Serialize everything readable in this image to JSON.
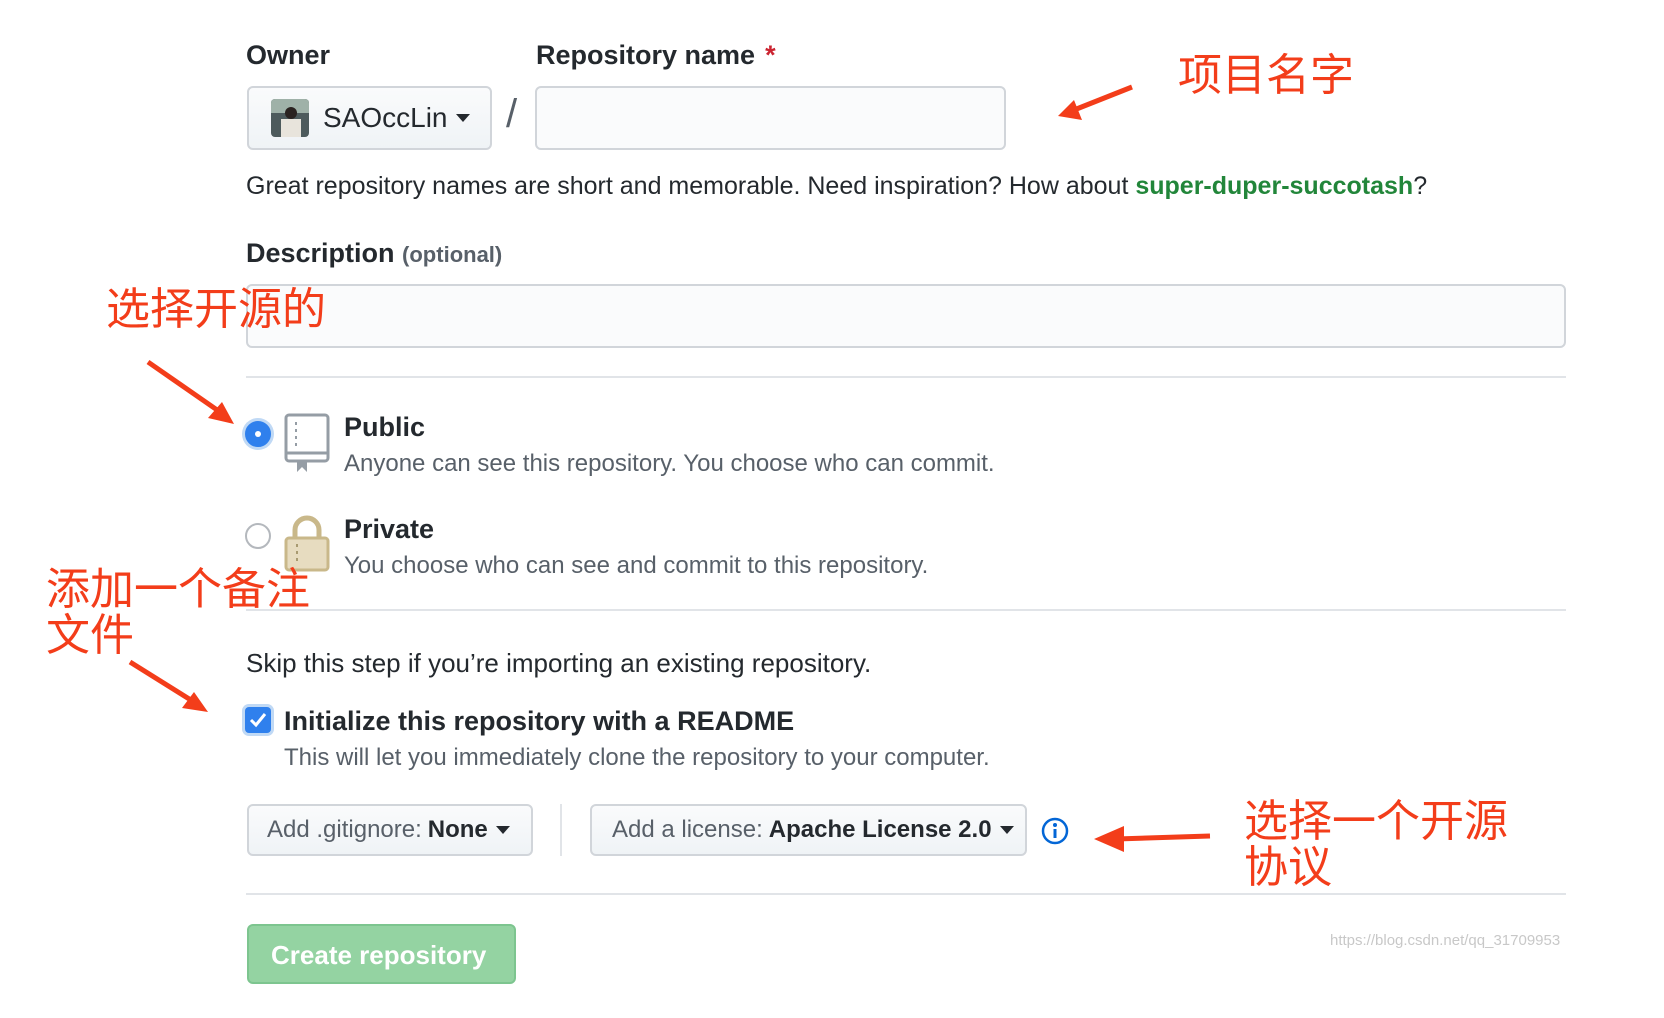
{
  "owner": {
    "label": "Owner",
    "name": "SAOccLin"
  },
  "repo": {
    "label": "Repository name",
    "required_mark": "*",
    "separator": "/",
    "value": ""
  },
  "hint": {
    "prefix": "Great repository names are short and memorable. Need inspiration? How about ",
    "suggestion": "super-duper-succotash",
    "suffix": "?"
  },
  "description": {
    "label": "Description",
    "optional": "(optional)",
    "value": ""
  },
  "visibility": {
    "public": {
      "title": "Public",
      "desc": "Anyone can see this repository. You choose who can commit.",
      "selected": true
    },
    "private": {
      "title": "Private",
      "desc": "You choose who can see and commit to this repository.",
      "selected": false
    }
  },
  "skip_text": "Skip this step if you’re importing an existing repository.",
  "readme": {
    "label": "Initialize this repository with a README",
    "desc": "This will let you immediately clone the repository to your computer.",
    "checked": true
  },
  "gitignore": {
    "prefix": "Add .gitignore:",
    "value": "None"
  },
  "license": {
    "prefix": "Add a license:",
    "value": "Apache License 2.0"
  },
  "create_button": "Create repository",
  "annotations": {
    "repo_name": "项目名字",
    "public": "选择开源的",
    "readme_line1": "添加一个备注",
    "readme_line2": "文件",
    "license_line1": "选择一个开源",
    "license_line2": "协议"
  },
  "watermark": "https://blog.csdn.net/qq_31709953",
  "colors": {
    "annotation": "#f33d1a",
    "suggestion": "#22863a",
    "accent": "#2f80ed",
    "create_button": "#94d3a2"
  },
  "icons": [
    "repo-book-icon",
    "lock-icon",
    "info-icon",
    "checkmark-icon",
    "caret-down-icon"
  ]
}
